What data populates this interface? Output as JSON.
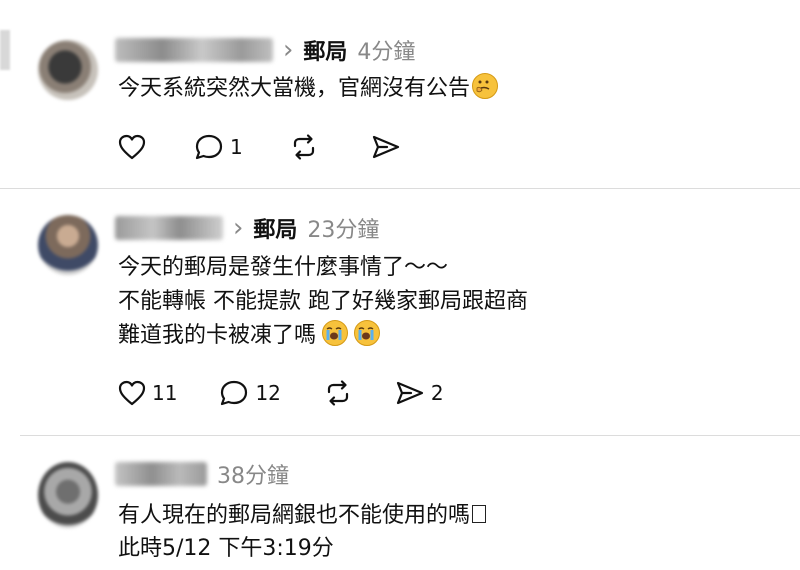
{
  "posts": [
    {
      "topic": "郵局",
      "time": "4分鐘",
      "lines": [
        "今天系統突然大當機，官網沒有公告"
      ],
      "likes": "",
      "replies": "1",
      "reposts": "",
      "shares": ""
    },
    {
      "topic": "郵局",
      "time": "23分鐘",
      "lines": [
        "今天的郵局是發生什麼事情了～～",
        "不能轉帳 不能提款 跑了好幾家郵局跟超商",
        "難道我的卡被凍了嗎"
      ],
      "likes": "11",
      "replies": "12",
      "reposts": "",
      "shares": "2"
    },
    {
      "time": "38分鐘",
      "lines": [
        "有人現在的郵局網銀也不能使用的嗎",
        "此時5/12 下午3:19分"
      ]
    }
  ],
  "icons": {
    "like": "heart-icon",
    "reply": "comment-bubble-icon",
    "repost": "repost-arrows-icon",
    "share": "send-icon",
    "thinking_emoji": "thinking-face-emoji",
    "crying_emoji": "loudly-crying-face-emoji"
  },
  "colors": {
    "muted": "#888888",
    "divider": "#dcdcdc",
    "emoji_yellow": "#f7c23c"
  }
}
